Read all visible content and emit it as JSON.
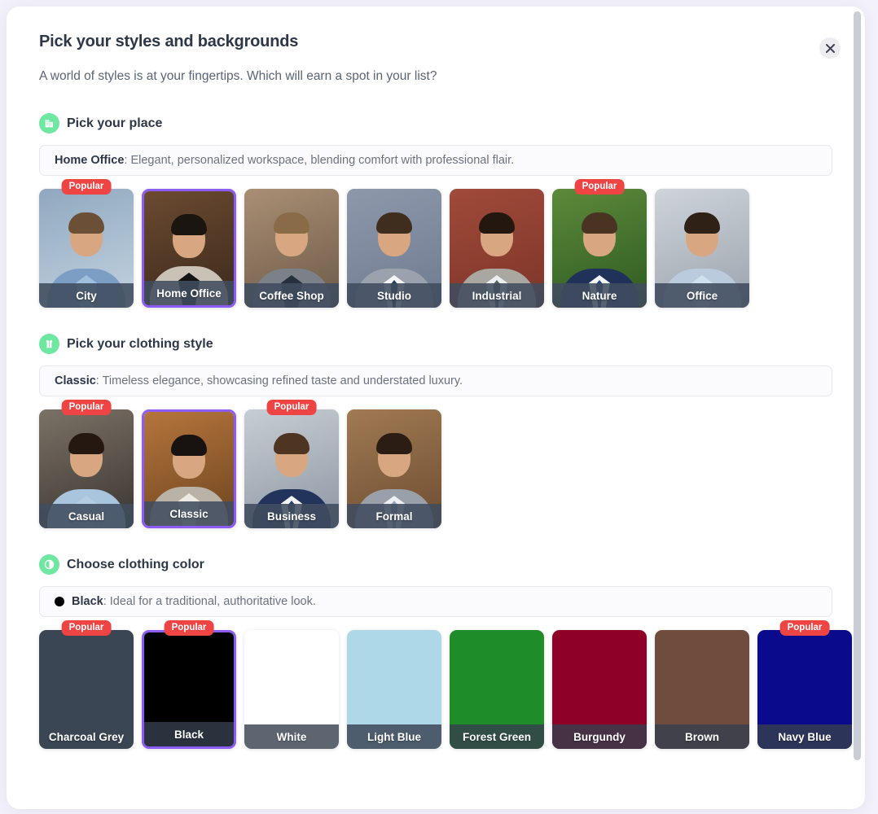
{
  "modal": {
    "title": "Pick your styles and backgrounds",
    "subtitle": "A world of styles is at your fingertips. Which will earn a spot in your list?",
    "close_label": "×"
  },
  "theme": {
    "accent_purple": "#8b5cf6",
    "badge_red": "#ef4444",
    "icon_green": "#6ee7a0",
    "label_bar": "#404c5f",
    "page_bg": "#f3f1fa"
  },
  "badge_text": "Popular",
  "sections": [
    {
      "id": "place",
      "icon": "building-icon",
      "title": "Pick your place",
      "info_name": "Home Office",
      "info_desc": ": Elegant, personalized workspace, blending comfort with professional flair.",
      "items": [
        {
          "label": "City",
          "selected": false,
          "popular": true,
          "bg1": "#8fa8bf",
          "bg2": "#c3d3e0",
          "body": "#7d9ec4",
          "hair": "#6b5037",
          "shirt": "#9fc0dc",
          "tie": ""
        },
        {
          "label": "Home Office",
          "selected": true,
          "popular": false,
          "bg1": "#6b4a30",
          "bg2": "#3c2a1c",
          "body": "#c9c2b6",
          "hair": "#1b1510",
          "shirt": "#141414",
          "tie": ""
        },
        {
          "label": "Coffee Shop",
          "selected": false,
          "popular": false,
          "bg1": "#a98f74",
          "bg2": "#6d5a48",
          "body": "#7c8189",
          "hair": "#8a6b48",
          "shirt": "#26303c",
          "tie": ""
        },
        {
          "label": "Studio",
          "selected": false,
          "popular": false,
          "bg1": "#8d98ab",
          "bg2": "#6f7b90",
          "body": "#9ba2ad",
          "hair": "#3f2d1e",
          "shirt": "#f4f5f7",
          "tie": "#1f3a66"
        },
        {
          "label": "Industrial",
          "selected": false,
          "popular": false,
          "bg1": "#a04a3a",
          "bg2": "#7c3528",
          "body": "#a9a79f",
          "hair": "#231710",
          "shirt": "#eceff2",
          "tie": "#5a5f66"
        },
        {
          "label": "Nature",
          "selected": false,
          "popular": true,
          "bg1": "#5c8a3a",
          "bg2": "#2f5a22",
          "body": "#20325a",
          "hair": "#4a3322",
          "shirt": "#f2f4f7",
          "tie": "#22457a"
        },
        {
          "label": "Office",
          "selected": false,
          "popular": false,
          "bg1": "#cfd4da",
          "bg2": "#9aa3ad",
          "body": "#b9cbdd",
          "hair": "#2f2116",
          "shirt": "#cfe0ee",
          "tie": ""
        }
      ]
    },
    {
      "id": "clothing-style",
      "icon": "clothing-icon",
      "title": "Pick your clothing style",
      "info_name": "Classic",
      "info_desc": ": Timeless elegance, showcasing refined taste and understated luxury.",
      "items": [
        {
          "label": "Casual",
          "selected": false,
          "popular": true,
          "bg1": "#7b7266",
          "bg2": "#3a3530",
          "body": "#a9c4dd",
          "hair": "#241811",
          "shirt": "#b4cde2",
          "tie": ""
        },
        {
          "label": "Classic",
          "selected": true,
          "popular": false,
          "bg1": "#b5753c",
          "bg2": "#6e4520",
          "body": "#b9b2a6",
          "hair": "#181210",
          "shirt": "#eceae2",
          "tie": ""
        },
        {
          "label": "Business",
          "selected": false,
          "popular": true,
          "bg1": "#c7cdd4",
          "bg2": "#8d97a3",
          "body": "#22335c",
          "hair": "#4e3521",
          "shirt": "#f3f5f8",
          "tie": "#23406e"
        },
        {
          "label": "Formal",
          "selected": false,
          "popular": false,
          "bg1": "#a07a53",
          "bg2": "#6d4d31",
          "body": "#9aa0a9",
          "hair": "#2b1d13",
          "shirt": "#eef0f3",
          "tie": "#8fa7bd"
        }
      ]
    },
    {
      "id": "clothing-color",
      "icon": "contrast-icon",
      "title": "Choose clothing color",
      "info_name": "Black",
      "info_desc": ": Ideal for a traditional, authoritative look.",
      "info_swatch_color": "#000000",
      "items": [
        {
          "label": "Charcoal Grey",
          "color": "#3b4654",
          "selected": false,
          "popular": true,
          "plain_label": true
        },
        {
          "label": "Black",
          "color": "#000000",
          "selected": true,
          "popular": true,
          "plain_label": false
        },
        {
          "label": "White",
          "color": "#ffffff",
          "selected": false,
          "popular": false,
          "plain_label": false
        },
        {
          "label": "Light Blue",
          "color": "#aed8e8",
          "selected": false,
          "popular": false,
          "plain_label": false
        },
        {
          "label": "Forest Green",
          "color": "#1f8c2a",
          "selected": false,
          "popular": false,
          "plain_label": false
        },
        {
          "label": "Burgundy",
          "color": "#8f0026",
          "selected": false,
          "popular": false,
          "plain_label": false
        },
        {
          "label": "Brown",
          "color": "#6f4c3c",
          "selected": false,
          "popular": false,
          "plain_label": false
        },
        {
          "label": "Navy Blue",
          "color": "#0a0a8c",
          "selected": false,
          "popular": true,
          "plain_label": false
        }
      ]
    }
  ]
}
